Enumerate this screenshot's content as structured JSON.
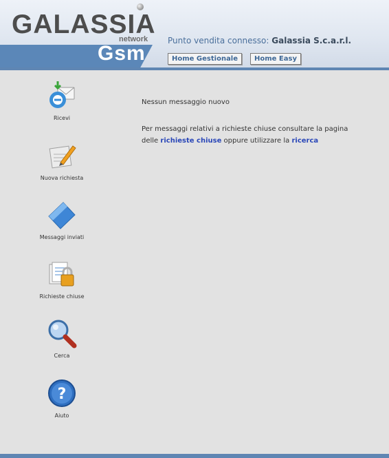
{
  "header": {
    "logo": {
      "brand": "GALASSIA",
      "network": "network",
      "product": "Gsm"
    },
    "store_label": "Punto vendita connesso:",
    "store_name": "Galassia S.c.a.r.l.",
    "nav": [
      {
        "label": "Home Gestionale"
      },
      {
        "label": "Home Easy"
      }
    ]
  },
  "sidebar": {
    "items": [
      {
        "label": "Ricevi",
        "icon": "receive-mail-icon"
      },
      {
        "label": "Nuova richiesta",
        "icon": "new-request-icon"
      },
      {
        "label": "Messaggi inviati",
        "icon": "sent-messages-icon"
      },
      {
        "label": "Richieste chiuse",
        "icon": "closed-requests-lock-icon"
      },
      {
        "label": "Cerca",
        "icon": "search-icon"
      },
      {
        "label": "Aiuto",
        "icon": "help-icon"
      }
    ]
  },
  "main": {
    "no_messages": "Nessun messaggio nuovo",
    "info_line1": "Per messaggi relativi a richieste chiuse consultare la pagina",
    "info_prefix": "delle",
    "closed_requests_link": "richieste chiuse",
    "info_middle": "oppure utilizzare la",
    "search_link": "ricerca"
  },
  "colors": {
    "accent": "#5f86b3",
    "link": "#2a47b8",
    "background": "#e2e2e2"
  }
}
